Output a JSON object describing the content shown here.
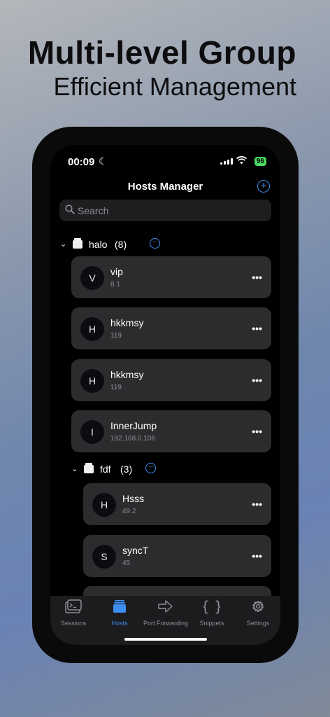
{
  "marketing": {
    "title": "Multi-level Group",
    "subtitle": "Efficient Management"
  },
  "status": {
    "time": "00:09",
    "battery": "96"
  },
  "nav": {
    "title": "Hosts Manager"
  },
  "search": {
    "placeholder": "Search"
  },
  "groups": [
    {
      "name": "halo",
      "count": "(8)"
    },
    {
      "name": "fdf",
      "count": "(3)"
    }
  ],
  "hosts": [
    {
      "initial": "V",
      "name": "vip",
      "address": "8.1"
    },
    {
      "initial": "H",
      "name": "hkkmsy",
      "address": "119"
    },
    {
      "initial": "H",
      "name": "hkkmsy",
      "address": "119"
    },
    {
      "initial": "I",
      "name": "InnerJump",
      "address": "192.168.0.106"
    },
    {
      "initial": "H",
      "name": "Hsss",
      "address": "49.2"
    },
    {
      "initial": "S",
      "name": "syncT",
      "address": "45"
    }
  ],
  "tabs": [
    {
      "label": "Sessions"
    },
    {
      "label": "Hosts"
    },
    {
      "label": "Port Forwarding"
    },
    {
      "label": "Snippets"
    },
    {
      "label": "Settings"
    }
  ],
  "colors": {
    "accent": "#3d8ef0",
    "card": "#2c2c2e",
    "battery": "#4cd964"
  },
  "icons": [
    "moon-icon",
    "cellular-signal-icon",
    "wifi-icon",
    "battery-icon",
    "plus-circle-icon",
    "search-icon",
    "folder-icon",
    "chevron-down-icon",
    "ellipsis-icon",
    "terminal-icon",
    "server-stack-icon",
    "arrow-right-icon",
    "braces-icon",
    "gear-icon"
  ]
}
